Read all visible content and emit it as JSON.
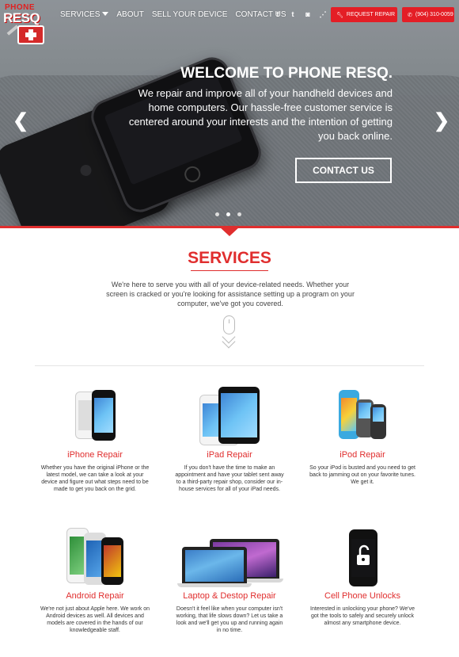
{
  "brand": {
    "top": "PHONE",
    "main": "RESQ"
  },
  "nav": {
    "items": [
      {
        "label": "SERVICES",
        "has_dropdown": true
      },
      {
        "label": "ABOUT"
      },
      {
        "label": "SELL YOUR DEVICE"
      },
      {
        "label": "CONTACT US"
      }
    ]
  },
  "social": {
    "facebook": "f",
    "twitter": "t",
    "instagram": "◙",
    "rss": "⋰"
  },
  "header_buttons": {
    "request_repair": "REQUEST REPAIR",
    "phone": "(904) 310-0059"
  },
  "hero": {
    "title": "WELCOME TO PHONE RESQ.",
    "text": "We repair and improve all of your handheld devices and home computers. Our hassle-free customer service is centered around your interests and the intention of getting you back online.",
    "cta": "CONTACT US",
    "slides": 3,
    "active_slide": 2
  },
  "services": {
    "title": "SERVICES",
    "intro": "We're here to serve you with all of your device-related needs. Whether your screen is cracked or you're looking for assistance setting up a program on your computer, we've got you covered.",
    "items": [
      {
        "name": "iPhone Repair",
        "desc": "Whether you have the original iPhone or the latest model, we can take a look at your device and figure out what steps need to be made to get you back on the grid."
      },
      {
        "name": "iPad Repair",
        "desc": "If you don't have the time to make an appointment and have your tablet sent away to a third-party repair shop, consider our in-house services for all of your iPad needs."
      },
      {
        "name": "iPod Repair",
        "desc": "So your iPod is busted and you need to get back to jamming out on your favorite tunes. We get it."
      },
      {
        "name": "Android Repair",
        "desc": "We're not just about Apple here. We work on Android devices as well. All devices and models are covered in the hands of our knowledgeable staff."
      },
      {
        "name": "Laptop & Destop Repair",
        "desc": "Doesn't it feel like when your computer isn't working, that life slows down? Let us take a look and we'll get you up and running again in no time."
      },
      {
        "name": "Cell Phone Unlocks",
        "desc": "Interested in unlocking your phone? We've got the tools to safely and securely unlock almost any smartphone device."
      }
    ]
  },
  "colors": {
    "accent": "#e02e2e",
    "button": "#e41e26"
  }
}
